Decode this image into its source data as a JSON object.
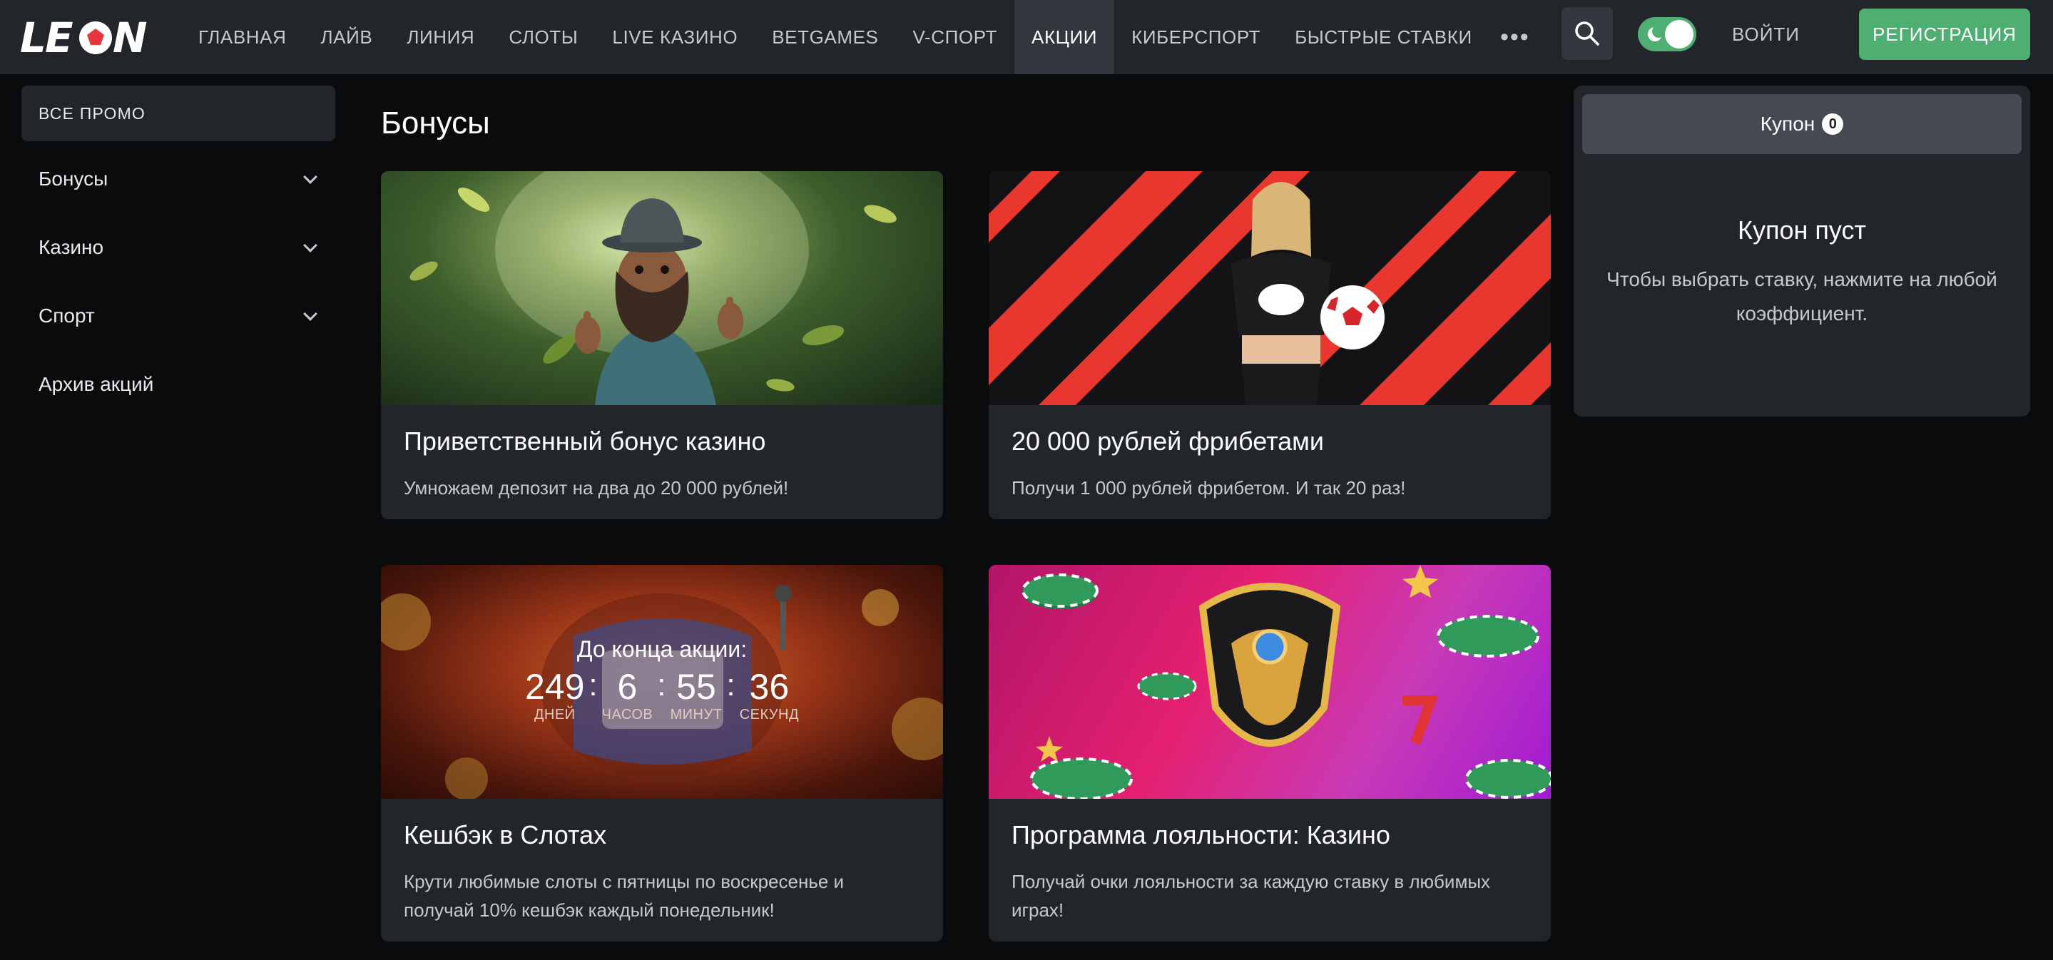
{
  "header": {
    "logo": "LEON",
    "nav": [
      {
        "label": "ГЛАВНАЯ",
        "active": false
      },
      {
        "label": "ЛАЙВ",
        "active": false
      },
      {
        "label": "ЛИНИЯ",
        "active": false
      },
      {
        "label": "СЛОТЫ",
        "active": false
      },
      {
        "label": "LIVE КАЗИНО",
        "active": false
      },
      {
        "label": "BETGAMES",
        "active": false
      },
      {
        "label": "V-СПОРТ",
        "active": false
      },
      {
        "label": "АКЦИИ",
        "active": true
      },
      {
        "label": "КИБЕРСПОРТ",
        "active": false
      },
      {
        "label": "БЫСТРЫЕ СТАВКИ",
        "active": false
      }
    ],
    "more_label": "•••",
    "login_label": "ВОЙТИ",
    "register_label": "РЕГИСТРАЦИЯ",
    "theme_toggle_on": true
  },
  "sidebar": {
    "all_promo_label": "ВСЕ ПРОМО",
    "items": [
      {
        "label": "Бонусы",
        "has_chevron": true
      },
      {
        "label": "Казино",
        "has_chevron": true
      },
      {
        "label": "Спорт",
        "has_chevron": true
      },
      {
        "label": "Архив акций",
        "has_chevron": false
      }
    ]
  },
  "main": {
    "title": "Бонусы",
    "cards": [
      {
        "title": "Приветственный бонус казино",
        "description": "Умножаем депозит на два до 20 000 рублей!"
      },
      {
        "title": "20 000 рублей фрибетами",
        "description": "Получи 1 000 рублей фрибетом. И так 20 раз!"
      },
      {
        "title": "Кешбэк в Слотах",
        "description": "Крути любимые слоты с пятницы по воскресенье и получай 10% кешбэк каждый понедельник!"
      },
      {
        "title": "Программа лояльности: Казино",
        "description": "Получай очки лояльности за каждую ставку в любимых играх!"
      }
    ],
    "countdown": {
      "title": "До конца акции:",
      "days": "249",
      "hours": "6",
      "minutes": "55",
      "seconds": "36",
      "days_label": "ДНЕЙ",
      "hours_label": "ЧАСОВ",
      "minutes_label": "МИНУТ",
      "seconds_label": "СЕКУНД"
    }
  },
  "coupon": {
    "tab_label": "Купон",
    "count": "0",
    "empty_title": "Купон пуст",
    "empty_text": "Чтобы выбрать ставку, нажмите на любой коэффициент."
  },
  "colors": {
    "header_bg": "#22252a",
    "page_bg": "#0a0b0d",
    "card_bg": "#22252a",
    "accent_green": "#4fae71",
    "active_nav_bg": "#33373d"
  },
  "icons": {
    "search": "search-icon",
    "theme": "moon-icon",
    "chevron": "chevron-down-icon"
  }
}
